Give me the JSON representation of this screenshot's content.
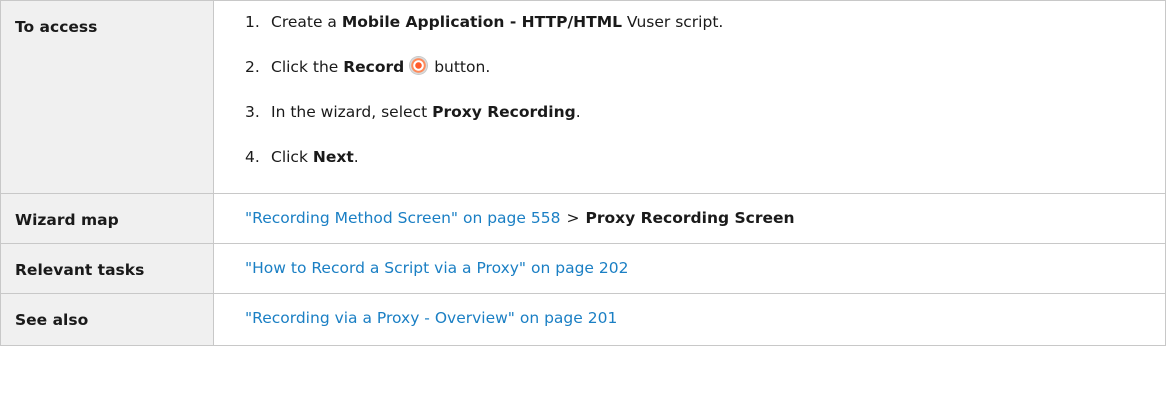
{
  "rows": {
    "access": {
      "label": "To access",
      "steps": [
        {
          "num": "1.",
          "pre": "Create a ",
          "bold": "Mobile Application - HTTP/HTML",
          "post": " Vuser script."
        },
        {
          "num": "2.",
          "pre": "Click the ",
          "bold": "Record",
          "post": " button."
        },
        {
          "num": "3.",
          "pre": "In the wizard, select ",
          "bold": "Proxy Recording",
          "post": "."
        },
        {
          "num": "4.",
          "pre": "Click ",
          "bold": "Next",
          "post": "."
        }
      ]
    },
    "wizard_map": {
      "label": "Wizard map",
      "link": "\"Recording Method Screen\" on page 558",
      "separator": ">",
      "current": "Proxy Recording Screen"
    },
    "relevant_tasks": {
      "label": "Relevant tasks",
      "link": "\"How to Record a Script via a Proxy\" on page 202"
    },
    "see_also": {
      "label": "See also",
      "link": "\"Recording via a Proxy - Overview\" on page 201"
    }
  },
  "icons": {
    "record": "record-icon"
  },
  "colors": {
    "link": "#1a7fc4",
    "label_bg": "#f0f0f0",
    "border": "#c8c8c8"
  }
}
